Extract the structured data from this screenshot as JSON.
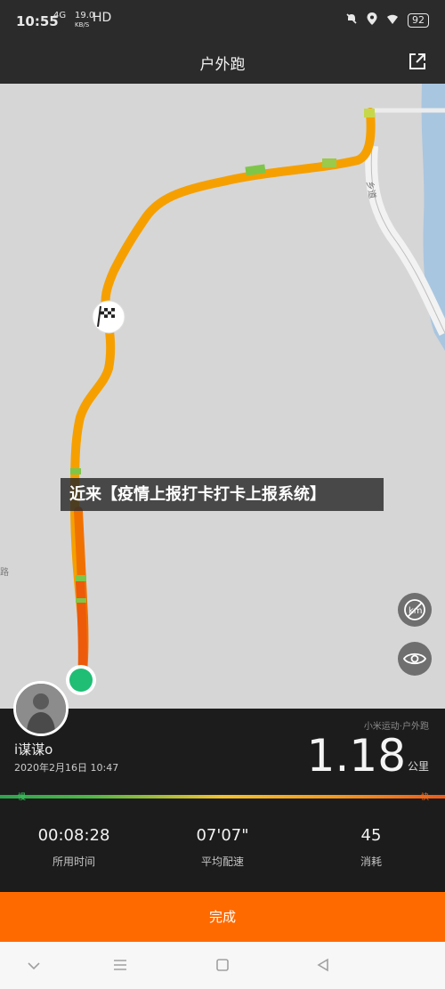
{
  "status": {
    "time": "10:55",
    "net_top": "4G",
    "net_speed": "19.0",
    "net_unit": "KB/S",
    "hd": "HD",
    "battery": "92"
  },
  "header": {
    "title": "户外跑"
  },
  "map": {
    "banner": "近来【疫情上报打卡打卡上报系统】",
    "route_colors": [
      "#f6a000",
      "#f37b00",
      "#ee5a0b",
      "#7ec64a"
    ],
    "start_color": "#1fbe74"
  },
  "summary": {
    "username": "i谋谋o",
    "date": "2020年2月16日 10:47",
    "brand": "小米运动·户外跑",
    "distance": "1.18",
    "unit": "公里",
    "bar_left": "慢",
    "bar_right": "快"
  },
  "stats": [
    {
      "value": "00:08:28",
      "label": "所用时间"
    },
    {
      "value": "07'07\"",
      "label": "平均配速"
    },
    {
      "value": "45",
      "label": "消耗"
    }
  ],
  "actions": {
    "finish": "完成"
  }
}
